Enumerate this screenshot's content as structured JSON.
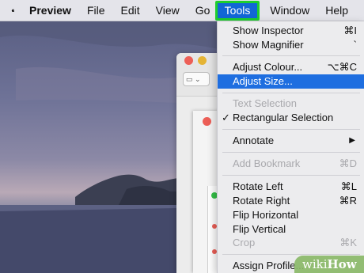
{
  "menubar": {
    "apple_icon": "apple-logo-icon",
    "app_name": "Preview",
    "items": [
      "File",
      "Edit",
      "View",
      "Go",
      "Tools",
      "Window",
      "Help"
    ],
    "active_item": "Tools",
    "highlight_color": "#1ecf2e",
    "active_bg": "#1266d6"
  },
  "tools_menu": {
    "items": [
      {
        "label": "Show Inspector",
        "shortcut": "⌘I",
        "enabled": true
      },
      {
        "label": "Show Magnifier",
        "shortcut": "`",
        "enabled": true
      },
      {
        "label": "Adjust Colour...",
        "shortcut": "⌥⌘C",
        "enabled": true
      },
      {
        "label": "Adjust Size...",
        "shortcut": "",
        "enabled": true,
        "highlighted": true
      },
      {
        "label": "Text Selection",
        "shortcut": "",
        "enabled": false
      },
      {
        "label": "Rectangular Selection",
        "shortcut": "",
        "enabled": true,
        "checked": true
      },
      {
        "label": "Annotate",
        "shortcut": "▶",
        "enabled": true,
        "submenu": true
      },
      {
        "label": "Add Bookmark",
        "shortcut": "⌘D",
        "enabled": false
      },
      {
        "label": "Rotate Left",
        "shortcut": "⌘L",
        "enabled": true
      },
      {
        "label": "Rotate Right",
        "shortcut": "⌘R",
        "enabled": true
      },
      {
        "label": "Flip Horizontal",
        "shortcut": "",
        "enabled": true
      },
      {
        "label": "Flip Vertical",
        "shortcut": "",
        "enabled": true
      },
      {
        "label": "Crop",
        "shortcut": "⌘K",
        "enabled": false
      },
      {
        "label": "Assign Profile...",
        "shortcut": "",
        "enabled": true
      }
    ],
    "highlight_bg": "#1e6ee0"
  },
  "watermark": {
    "prefix": "wiki",
    "suffix": "How"
  }
}
